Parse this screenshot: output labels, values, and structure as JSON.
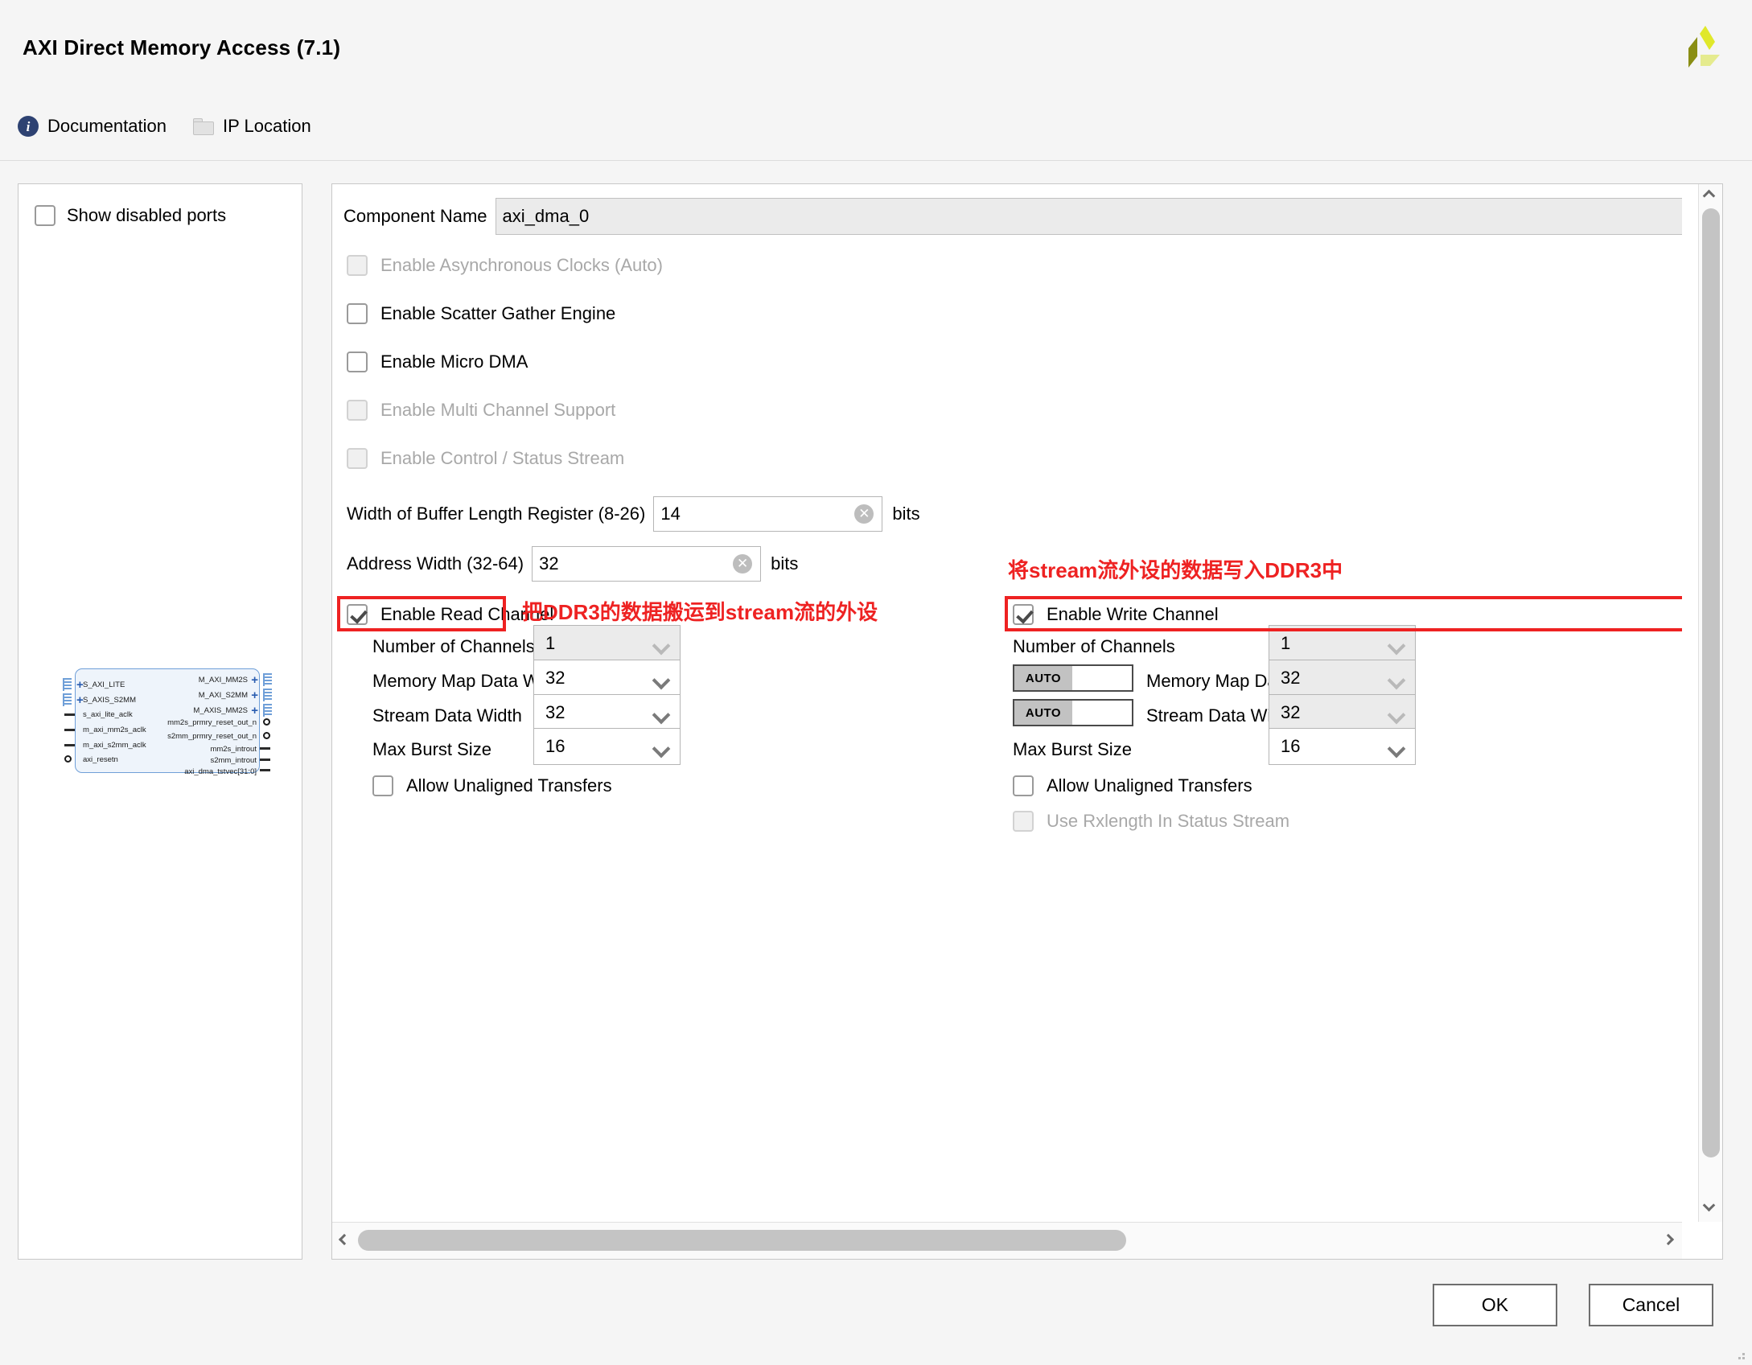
{
  "dialog": {
    "title": "AXI Direct Memory Access (7.1)",
    "logo_name": "xilinx-logo"
  },
  "toolbar": {
    "documentation_label": "Documentation",
    "ip_location_label": "IP Location"
  },
  "ports_panel": {
    "show_disabled_label": "Show disabled ports",
    "show_disabled_checked": false,
    "symbol": {
      "left_bus_ports": [
        "S_AXI_LITE",
        "S_AXIS_S2MM"
      ],
      "left_signal_ports": [
        "s_axi_lite_aclk",
        "m_axi_mm2s_aclk",
        "m_axi_s2mm_aclk",
        "axi_resetn"
      ],
      "right_bus_ports": [
        "M_AXI_MM2S",
        "M_AXI_S2MM",
        "M_AXIS_MM2S"
      ],
      "right_signal_ports": [
        "mm2s_prmry_reset_out_n",
        "s2mm_prmry_reset_out_n",
        "mm2s_introut",
        "s2mm_introut",
        "axi_dma_tstvec[31:0]"
      ]
    }
  },
  "config": {
    "component_name_label": "Component Name",
    "component_name_value": "axi_dma_0",
    "options": [
      {
        "label": "Enable Asynchronous Clocks (Auto)",
        "checked": false,
        "disabled": true
      },
      {
        "label": "Enable Scatter Gather Engine",
        "checked": false,
        "disabled": false
      },
      {
        "label": "Enable Micro DMA",
        "checked": false,
        "disabled": false
      },
      {
        "label": "Enable Multi Channel Support",
        "checked": false,
        "disabled": true
      },
      {
        "label": "Enable Control / Status Stream",
        "checked": false,
        "disabled": true
      }
    ],
    "buffer_length": {
      "label": "Width of Buffer Length Register (8-26)",
      "value": "14",
      "units": "bits"
    },
    "address_width": {
      "label": "Address Width (32-64)",
      "value": "32",
      "units": "bits"
    },
    "read_channel": {
      "enable_label": "Enable Read Channel",
      "enabled": true,
      "fields": [
        {
          "label": "Number of Channels",
          "value": "1",
          "disabled": true
        },
        {
          "label": "Memory Map Data Width",
          "value": "32",
          "disabled": false
        },
        {
          "label": "Stream Data Width",
          "value": "32",
          "disabled": false
        },
        {
          "label": "Max Burst Size",
          "value": "16",
          "disabled": false
        }
      ],
      "allow_unaligned_label": "Allow Unaligned Transfers",
      "allow_unaligned_checked": false
    },
    "write_channel": {
      "enable_label": "Enable Write Channel",
      "enabled": true,
      "auto_badge": "AUTO",
      "fields": [
        {
          "label": "Number of Channels",
          "value": "1",
          "disabled": true,
          "auto": false
        },
        {
          "label": "Memory Map Data Width",
          "value": "32",
          "disabled": true,
          "auto": true
        },
        {
          "label": "Stream Data Width",
          "value": "32",
          "disabled": true,
          "auto": true
        },
        {
          "label": "Max Burst Size",
          "value": "16",
          "disabled": false,
          "auto": false
        }
      ],
      "allow_unaligned_label": "Allow Unaligned Transfers",
      "allow_unaligned_checked": false,
      "use_rxlength_label": "Use Rxlength In Status Stream",
      "use_rxlength_checked": false,
      "use_rxlength_disabled": true
    }
  },
  "annotations": {
    "accent_color": "#ee2222",
    "read_note": "把DDR3的数据搬运到stream流的外设",
    "write_note": "将stream流外设的数据写入DDR3中"
  },
  "footer": {
    "ok_label": "OK",
    "cancel_label": "Cancel"
  }
}
